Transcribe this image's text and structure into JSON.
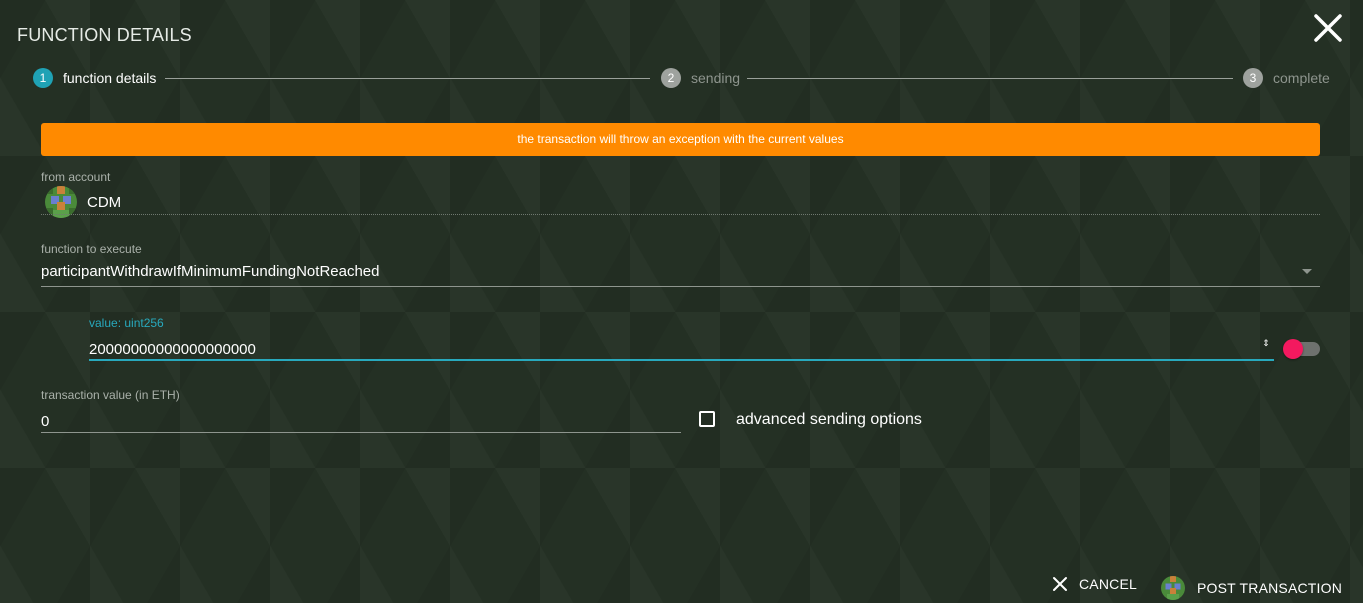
{
  "dialog": {
    "title": "FUNCTION DETAILS"
  },
  "stepper": {
    "steps": [
      {
        "number": "1",
        "label": "function details",
        "state": "active"
      },
      {
        "number": "2",
        "label": "sending",
        "state": "inactive"
      },
      {
        "number": "3",
        "label": "complete",
        "state": "inactive"
      }
    ]
  },
  "warning": {
    "text": "the transaction will throw an exception with the current values",
    "color": "#ff8a00"
  },
  "from_account": {
    "label": "from account",
    "name": "CDM",
    "icon": "identicon-avatar"
  },
  "function_select": {
    "label": "function to execute",
    "value": "participantWithdrawIfMinimumFundingNotReached"
  },
  "value_param": {
    "label": "value: uint256",
    "value": "20000000000000000000",
    "spinner_glyph": "⇕",
    "toggle_on": true,
    "toggle_color": "#f3195f"
  },
  "transaction_value": {
    "label": "transaction value (in ETH)",
    "value": "0"
  },
  "advanced": {
    "label": "advanced sending options",
    "checked": false
  },
  "footer": {
    "cancel_label": "CANCEL",
    "post_label": "POST TRANSACTION"
  },
  "colors": {
    "accent": "#1fa2b5",
    "focus_line": "#28a9bd"
  }
}
